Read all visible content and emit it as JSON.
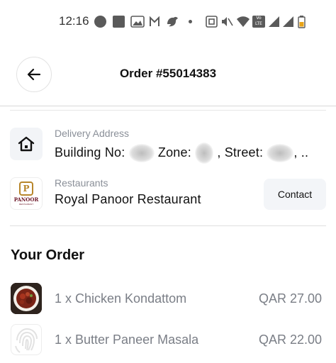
{
  "status_bar": {
    "time": "12:16",
    "icons": [
      "notification-dot-icon",
      "square-icon",
      "gallery-icon",
      "gmail-icon",
      "bird-icon",
      "dot-icon",
      "nfc-icon",
      "mute-icon",
      "wifi-icon",
      "volte-icon",
      "signal-icon",
      "signal-icon",
      "battery-icon"
    ],
    "volte_text": "Vo LTE"
  },
  "header": {
    "title": "Order #55014383",
    "back_icon": "arrow-left-icon"
  },
  "delivery": {
    "label": "Delivery Address",
    "building_prefix": "Building No:",
    "zone_prefix": "Zone:",
    "street_prefix": ", Street:",
    "suffix": ", ..",
    "icon": "house-icon"
  },
  "restaurant": {
    "label": "Restaurants",
    "name": "Royal Panoor Restaurant",
    "logo_text": "PANOOR",
    "logo_sub": "RESTAURANT",
    "logo_letter": "P",
    "contact_label": "Contact"
  },
  "order": {
    "title": "Your Order",
    "items": [
      {
        "name": "1 x Chicken Kondattom",
        "price": "QAR 27.00",
        "thumb": "dish-photo"
      },
      {
        "name": "1 x Butter Paneer Masala",
        "price": "QAR 22.00",
        "thumb": "placeholder-fingerprint-icon"
      }
    ]
  },
  "colors": {
    "accent_gold": "#b8862b",
    "logo_maroon": "#6b1526",
    "muted_text": "#7a7e86",
    "panel_bg": "#f2f4f7"
  }
}
